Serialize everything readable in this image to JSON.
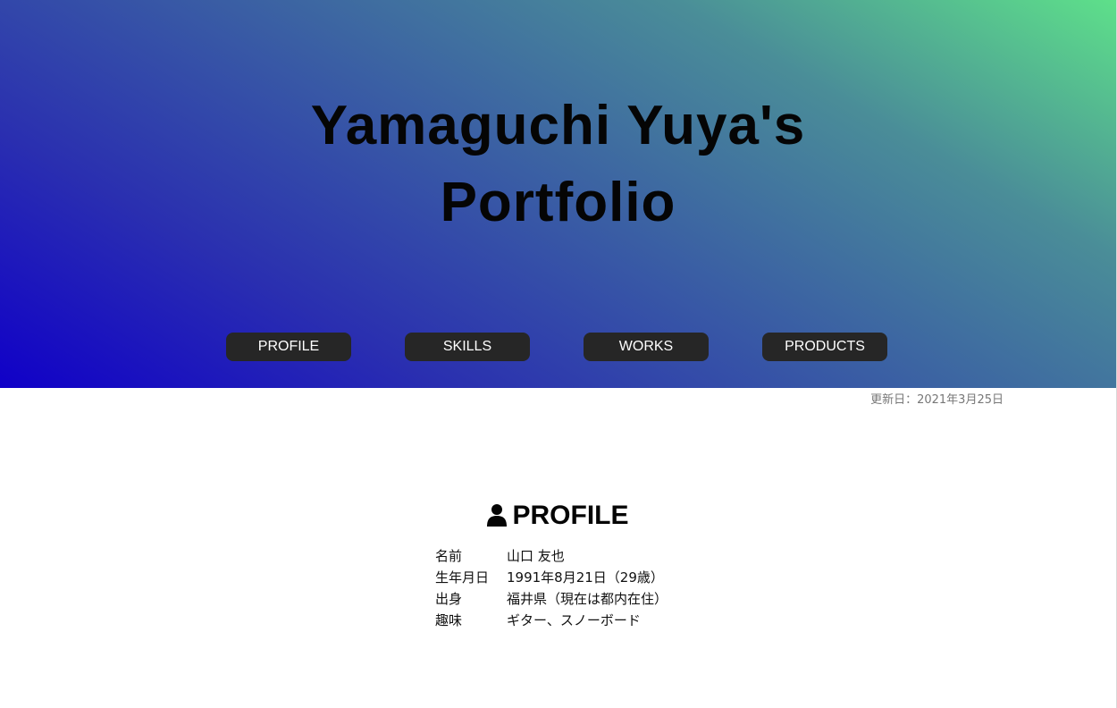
{
  "hero": {
    "title_line1": "Yamaguchi Yuya's",
    "title_line2": "Portfolio",
    "gradient_colors": [
      "#1000c8",
      "#3a5ea4",
      "#5ee08a"
    ]
  },
  "nav": {
    "items": [
      {
        "label": "PROFILE"
      },
      {
        "label": "SKILLS"
      },
      {
        "label": "WORKS"
      },
      {
        "label": "PRODUCTS"
      }
    ],
    "button_color": "#262626"
  },
  "updated": "更新日：2021年3月25日",
  "profile": {
    "icon": "user-icon",
    "heading": "PROFILE",
    "rows": [
      {
        "key": "名前",
        "value": "山口 友也"
      },
      {
        "key": "生年月日",
        "value": "1991年8月21日（29歳）"
      },
      {
        "key": "出身",
        "value": "福井県（現在は都内在住）"
      },
      {
        "key": "趣味",
        "value": "ギター、スノーボード"
      }
    ]
  }
}
